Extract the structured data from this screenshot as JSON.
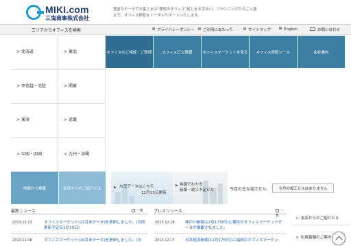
{
  "header": {
    "logo_text": "MIKI.com",
    "logo_sub": "三鬼商事株式会社",
    "tagline": "豊富なデータでお客さまの\"理想のオフィス\"探しをお手伝い。プランニングからご入居まで、オフィス移転をトータルサポートいたします。"
  },
  "subbar": {
    "area_title": "エリアからオフィスを検索",
    "links": [
      "プライバシーポリシー",
      "ご利用にあたって",
      "サイトマップ",
      "English",
      "お問い合わせ"
    ]
  },
  "areas": [
    {
      "label": "北海道"
    },
    {
      "label": "東北"
    },
    {
      "label": "甲信越・北陸"
    },
    {
      "label": "関東"
    },
    {
      "label": "東海"
    },
    {
      "label": "近畿"
    },
    {
      "label": "中国・四国"
    },
    {
      "label": "九州・沖縄"
    }
  ],
  "nav": [
    "オフィスのご相談・ご質問",
    "オフィスビル情報",
    "オフィスマーケットを見る",
    "オフィス移転ツール",
    "会社案内"
  ],
  "banners": {
    "map_search": "地図から検索",
    "branch_building": "支店からのご紹介ビル",
    "market_line1": "市況データはこちら",
    "market_line2": "12月13日更新",
    "map_line1": "地図でわかる",
    "map_line2": "新築・竣工予定ビル",
    "new_building_label": "今月の主な竣工ビル",
    "new_building_btn": "今月の竣工ビルはありません"
  },
  "latest_news": {
    "title": "最新ニュース",
    "more": "一覧",
    "items": [
      {
        "date": "2013.12.13",
        "text": "オフィスマーケット(11月末データ)を更新しました。(次回更新予定日1月10日)"
      },
      {
        "date": "2013.11.08",
        "text": "オフィスマーケット(10月末データ)を更新しました。(次"
      }
    ]
  },
  "press": {
    "title": "プレスリリース",
    "more": "一覧",
    "items": [
      {
        "date": "2013.12.18",
        "text": "神戸川新聞(12月17日付)に横浜のオフィスマーケットデータが掲載されました。"
      },
      {
        "date": "2013.12.17",
        "text": "日本経済新聞(12月17日付)に福岡のオフィスマーケッ"
      }
    ]
  },
  "side_links": [
    "支店からのご紹介ビル",
    "札幌直轄のご案内"
  ],
  "colors": {
    "nav_blue": "#3d7ea2",
    "banner_blue": "#6aa3c4",
    "logo_navy": "#1f3c78",
    "logo_cyan": "#1c9bd4",
    "link_blue": "#1c62b5"
  }
}
